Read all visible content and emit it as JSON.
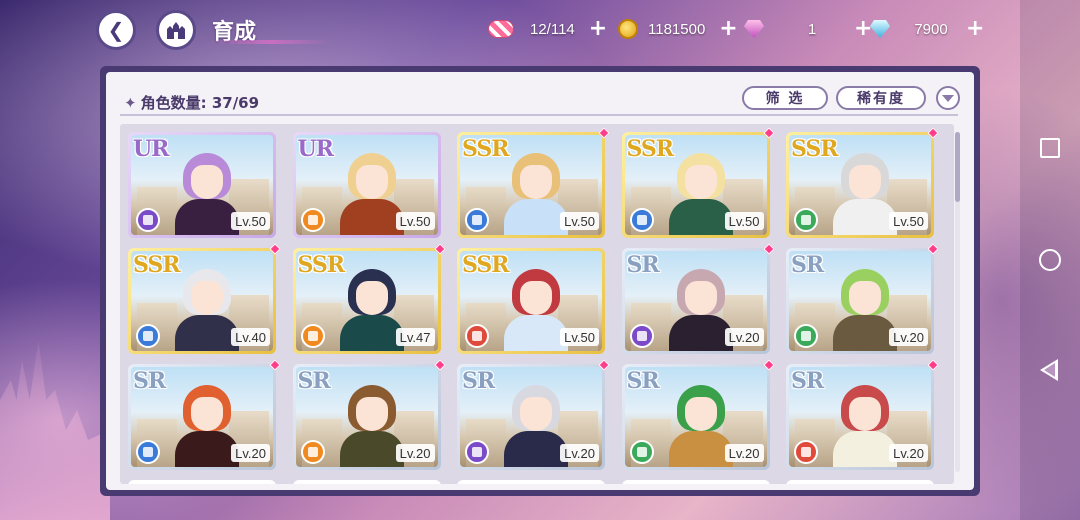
{
  "header": {
    "title": "育成",
    "resources": {
      "candy": "12/114",
      "gold": "1181500",
      "pink_gem": "1",
      "blue_gem": "7900"
    }
  },
  "panel": {
    "count_label": "角色数量",
    "count_value": "37/69",
    "filter_label": "筛 选",
    "rarity_label": "稀有度"
  },
  "colors": {
    "UR": "#9a6ac8",
    "SSR": "#e0a820",
    "SR": "#8aa0c0",
    "type_purple": "#7a4ac8",
    "type_blue": "#3a7ad8",
    "type_orange": "#f08a20",
    "type_green": "#3aaa5a",
    "type_red": "#e04a3a",
    "new_marker": "#ff3d8a"
  },
  "characters": [
    {
      "rarity": "UR",
      "level": "Lv.50",
      "type": "purple",
      "new": false,
      "hair": "#b88ad8",
      "outfit": "#3a2040"
    },
    {
      "rarity": "UR",
      "level": "Lv.50",
      "type": "orange",
      "new": false,
      "hair": "#f0d090",
      "outfit": "#a04020"
    },
    {
      "rarity": "SSR",
      "level": "Lv.50",
      "type": "blue",
      "new": true,
      "hair": "#e8c078",
      "outfit": "#c8e0f8"
    },
    {
      "rarity": "SSR",
      "level": "Lv.50",
      "type": "blue",
      "new": true,
      "hair": "#f4e0a0",
      "outfit": "#2a6048"
    },
    {
      "rarity": "SSR",
      "level": "Lv.50",
      "type": "green",
      "new": true,
      "hair": "#d8d8d8",
      "outfit": "#f0f0f0"
    },
    {
      "rarity": "SSR",
      "level": "Lv.40",
      "type": "blue",
      "new": true,
      "hair": "#e8e8ec",
      "outfit": "#30304a"
    },
    {
      "rarity": "SSR",
      "level": "Lv.47",
      "type": "orange",
      "new": true,
      "hair": "#2a3050",
      "outfit": "#1a4a4a"
    },
    {
      "rarity": "SSR",
      "level": "Lv.50",
      "type": "red",
      "new": false,
      "hair": "#c03a40",
      "outfit": "#d8e8f8"
    },
    {
      "rarity": "SR",
      "level": "Lv.20",
      "type": "purple",
      "new": true,
      "hair": "#c8a8b0",
      "outfit": "#2a2030"
    },
    {
      "rarity": "SR",
      "level": "Lv.20",
      "type": "green",
      "new": true,
      "hair": "#9ad060",
      "outfit": "#6a5a40"
    },
    {
      "rarity": "SR",
      "level": "Lv.20",
      "type": "blue",
      "new": true,
      "hair": "#e06030",
      "outfit": "#3a1a1a"
    },
    {
      "rarity": "SR",
      "level": "Lv.20",
      "type": "orange",
      "new": true,
      "hair": "#8a5a30",
      "outfit": "#4a4a2a"
    },
    {
      "rarity": "SR",
      "level": "Lv.20",
      "type": "purple",
      "new": true,
      "hair": "#d8d8e0",
      "outfit": "#2a2a4a"
    },
    {
      "rarity": "SR",
      "level": "Lv.20",
      "type": "green",
      "new": true,
      "hair": "#3aa04a",
      "outfit": "#c89040"
    },
    {
      "rarity": "SR",
      "level": "Lv.20",
      "type": "red",
      "new": true,
      "hair": "#c84a4a",
      "outfit": "#f4f0e0"
    }
  ]
}
